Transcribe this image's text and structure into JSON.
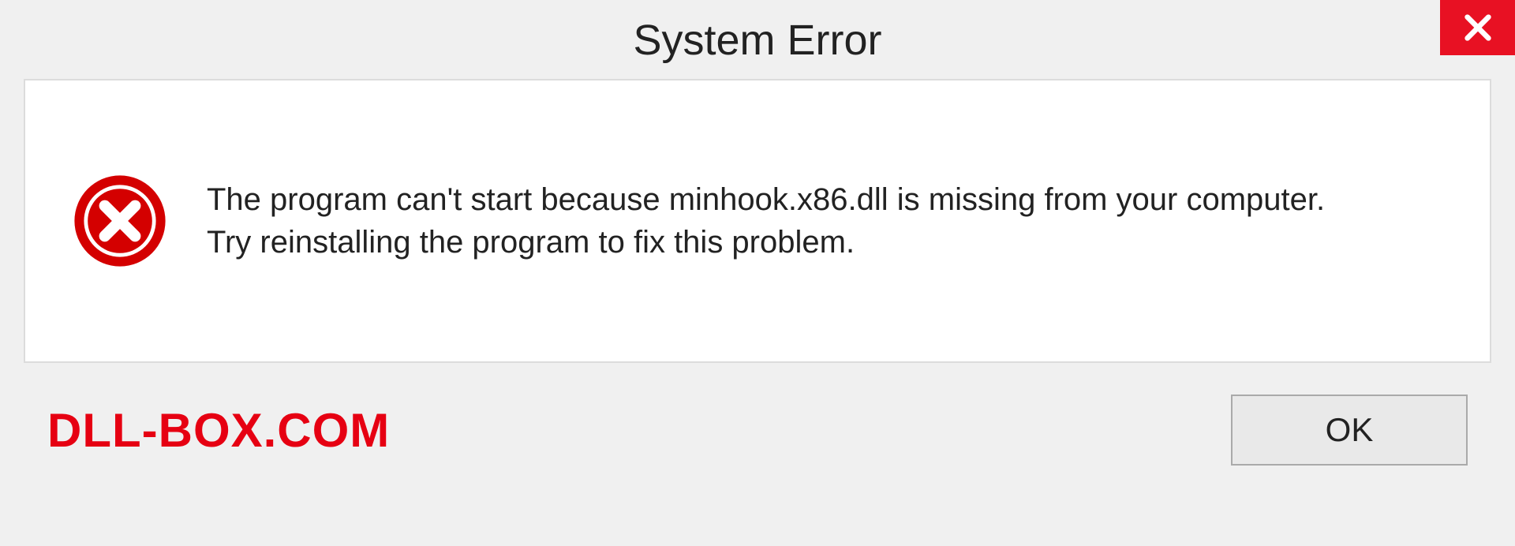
{
  "dialog": {
    "title": "System Error",
    "message": "The program can't start because minhook.x86.dll is missing from your computer. Try reinstalling the program to fix this problem.",
    "ok_label": "OK"
  },
  "watermark": "DLL-BOX.COM"
}
